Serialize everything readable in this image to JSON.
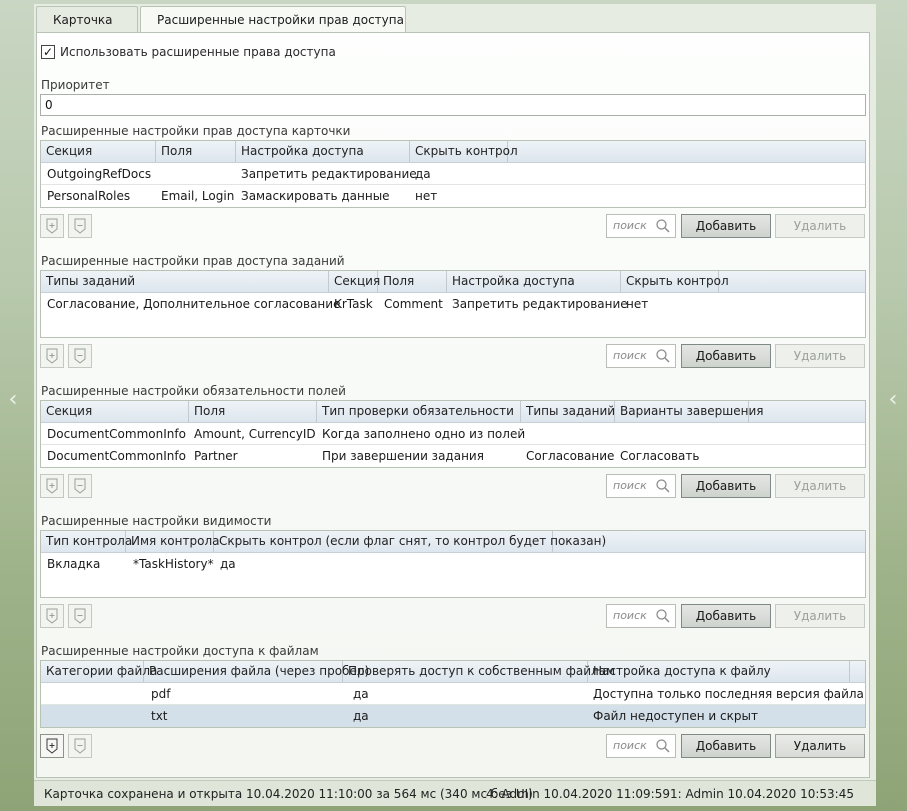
{
  "tabs": [
    "Карточка",
    "Расширенные настройки прав доступа"
  ],
  "use_extended": {
    "label": "Использовать расширенные права доступа",
    "checked": true
  },
  "priority": {
    "label": "Приоритет",
    "value": "0"
  },
  "search_placeholder": "поиск",
  "add_label": "Добавить",
  "delete_label": "Удалить",
  "sections": [
    {
      "title": "Расширенные настройки прав доступа карточки",
      "columns": [
        "Секция",
        "Поля",
        "Настройка доступа",
        "Скрыть контрол"
      ],
      "rows": [
        [
          "OutgoingRefDocs",
          "",
          "Запретить редактирование",
          "да"
        ],
        [
          "PersonalRoles",
          "Email, Login",
          "Замаскировать данные",
          "нет"
        ]
      ]
    },
    {
      "title": "Расширенные настройки прав доступа заданий",
      "columns": [
        "Типы заданий",
        "Секция",
        "Поля",
        "Настройка доступа",
        "Скрыть контрол"
      ],
      "rows": [
        [
          "Согласование, Дополнительное согласование",
          "KrTask",
          "Comment",
          "Запретить редактирование",
          "нет"
        ]
      ]
    },
    {
      "title": "Расширенные настройки обязательности полей",
      "columns": [
        "Секция",
        "Поля",
        "Тип проверки обязательности",
        "Типы заданий",
        "Варианты завершения"
      ],
      "rows": [
        [
          "DocumentCommonInfo",
          "Amount, CurrencyID",
          "Когда заполнено одно из полей",
          "",
          ""
        ],
        [
          "DocumentCommonInfo",
          "Partner",
          "При завершении задания",
          "Согласование",
          "Согласовать"
        ]
      ]
    },
    {
      "title": "Расширенные настройки видимости",
      "columns": [
        "Тип контрола",
        "Имя контрола",
        "Скрыть контрол (если флаг снят, то контрол будет показан)"
      ],
      "rows": [
        [
          "Вкладка",
          "*TaskHistory*",
          "да"
        ]
      ]
    },
    {
      "title": "Расширенные настройки доступа к файлам",
      "columns": [
        "Категории файла",
        "Расширения файла (через пробел)",
        "Проверять доступ к собственным файлам",
        "Настройка доступа к файлу"
      ],
      "rows": [
        [
          "",
          "pdf",
          "да",
          "Доступна только последняя версия файла"
        ],
        [
          "",
          "txt",
          "да",
          "Файл недоступен и скрыт"
        ]
      ]
    }
  ],
  "status": {
    "saved": "Карточка сохранена и открыта 10.04.2020 11:10:00 за 564 мс (340 мс без UI)",
    "version4": "4:  Admin  10.04.2020 11:09:59",
    "version1": "1:  Admin  10.04.2020 10:53:45"
  }
}
